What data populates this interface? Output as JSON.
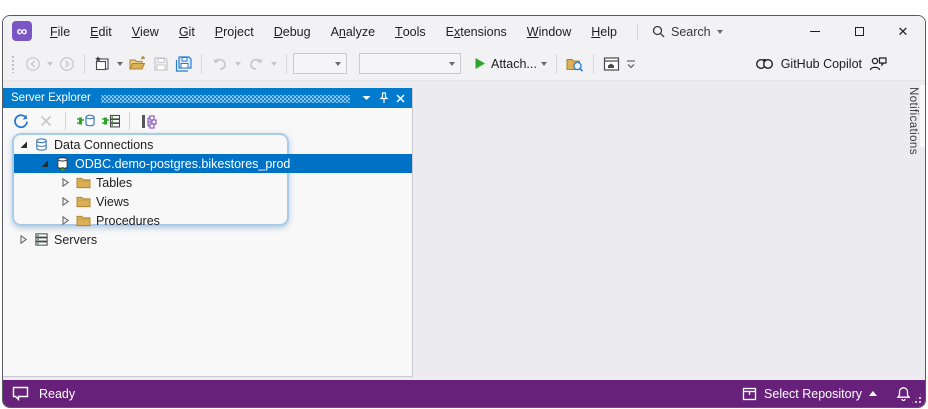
{
  "titlebar": {
    "menus": [
      {
        "label": "File",
        "mnemonic": 0
      },
      {
        "label": "Edit",
        "mnemonic": 0
      },
      {
        "label": "View",
        "mnemonic": 0
      },
      {
        "label": "Git",
        "mnemonic": 0
      },
      {
        "label": "Project",
        "mnemonic": 0
      },
      {
        "label": "Debug",
        "mnemonic": 0
      },
      {
        "label": "Analyze",
        "mnemonic": 1
      },
      {
        "label": "Tools",
        "mnemonic": 0
      },
      {
        "label": "Extensions",
        "mnemonic": 1
      },
      {
        "label": "Window",
        "mnemonic": 0
      },
      {
        "label": "Help",
        "mnemonic": 0
      }
    ],
    "search_label": "Search"
  },
  "toolbar": {
    "attach_label": "Attach...",
    "github_copilot_label": "GitHub Copilot"
  },
  "server_explorer": {
    "title": "Server Explorer",
    "tree_items": [
      {
        "label": "Data Connections",
        "level": 0,
        "state": "expanded",
        "icon": "data-connections-icon",
        "selected": false
      },
      {
        "label": "ODBC.demo-postgres.bikestores_prod",
        "level": 1,
        "state": "expanded",
        "icon": "database-connection-icon",
        "selected": true
      },
      {
        "label": "Tables",
        "level": 2,
        "state": "collapsed",
        "icon": "folder-icon",
        "selected": false
      },
      {
        "label": "Views",
        "level": 2,
        "state": "collapsed",
        "icon": "folder-icon",
        "selected": false
      },
      {
        "label": "Procedures",
        "level": 2,
        "state": "collapsed",
        "icon": "folder-icon",
        "selected": false
      },
      {
        "label": "Servers",
        "level": 0,
        "state": "collapsed",
        "icon": "servers-icon",
        "selected": false
      }
    ]
  },
  "right_edge": {
    "notifications_label": "Notifications"
  },
  "statusbar": {
    "ready_label": "Ready",
    "select_repository_label": "Select Repository"
  },
  "colors": {
    "accent_blue": "#007ACC",
    "selection_blue": "#0072C6",
    "status_purple": "#68217A",
    "logo_purple": "#7B55C6",
    "folder_gold": "#DCB056",
    "run_green": "#2DA52D",
    "highlight_box_blue": "#A9CBEA"
  }
}
